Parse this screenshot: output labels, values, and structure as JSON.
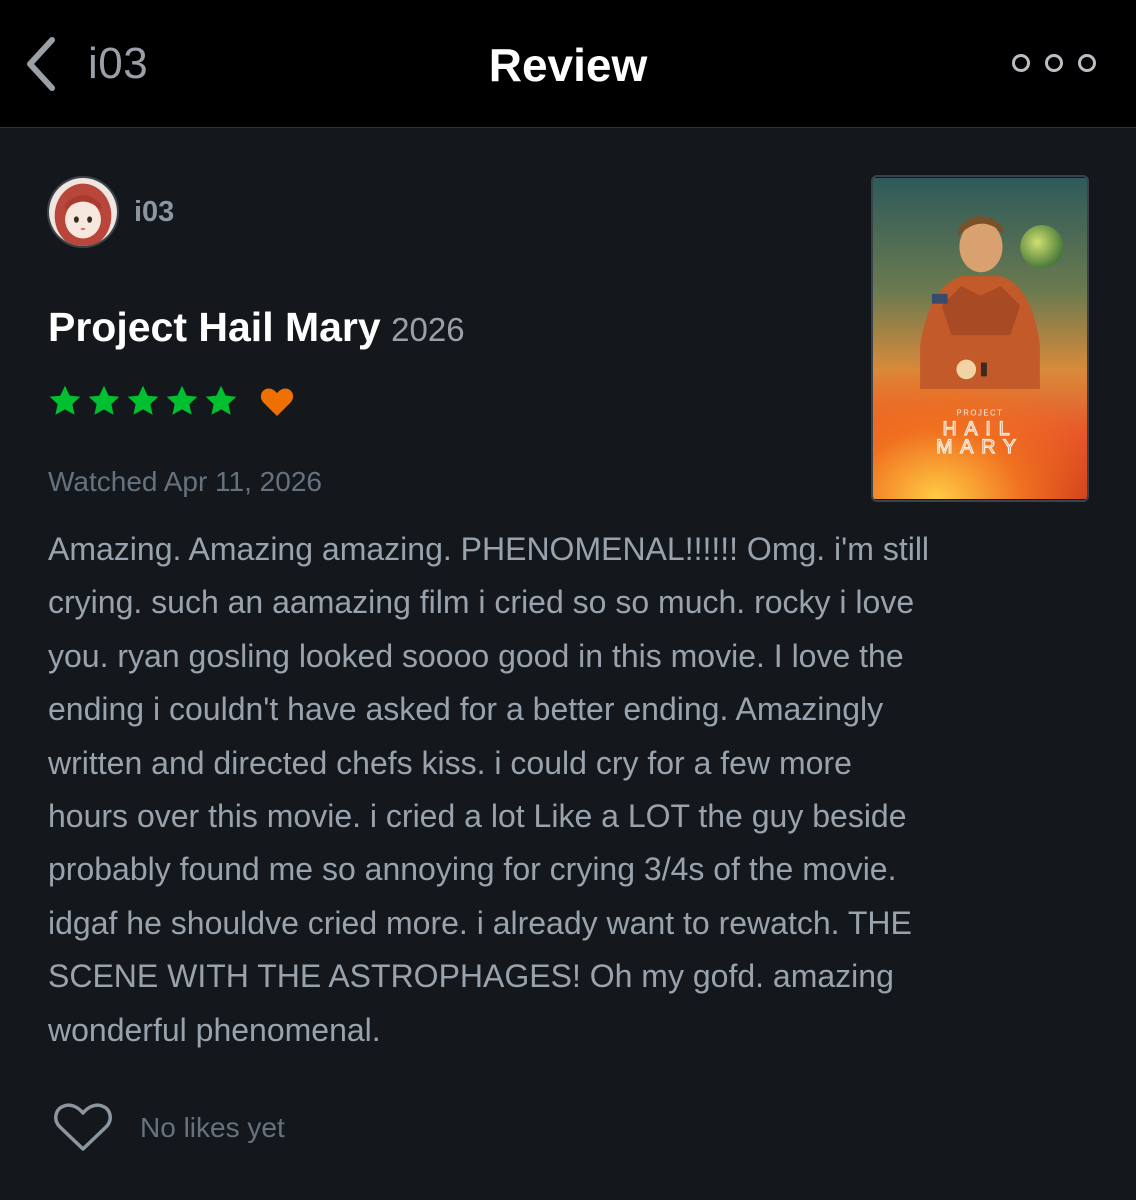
{
  "header": {
    "back_label": "i03",
    "title": "Review"
  },
  "reviewer": {
    "username": "i03"
  },
  "film": {
    "title": "Project Hail Mary",
    "year": "2026",
    "poster_text_small": "PROJECT",
    "poster_text_line1": "HAIL",
    "poster_text_line2": "MARY"
  },
  "rating": {
    "stars": 5,
    "max_stars": 5,
    "liked": true,
    "star_color": "#00c030",
    "heart_color": "#ee7000"
  },
  "watched": "Watched Apr 11, 2026",
  "review": {
    "lines": [
      "Amazing. Amazing amazing. PHENOMENAL!!!!!! Omg. i'm still",
      "crying. such an aamazing film i cried so so much. rocky i love",
      "you. ryan gosling looked soooo good in this movie. I love the",
      "ending i couldn't have asked for a better ending. Amazingly",
      "written and directed chefs kiss. i could cry for a few more",
      "hours over this movie. i cried a lot Like a LOT the guy beside",
      "probably found me so annoying for crying 3/4s of the movie.",
      "idgaf he shouldve cried more. i already want to rewatch. THE",
      "SCENE WITH THE ASTROPHAGES! Oh my gofd. amazing",
      "wonderful phenomenal."
    ]
  },
  "likes": {
    "text": "No likes yet"
  },
  "icons": {
    "back": "chevron-left-icon",
    "more": "more-dots-icon",
    "star": "star-icon",
    "liked": "heart-filled-icon",
    "like_button": "heart-outline-icon"
  }
}
